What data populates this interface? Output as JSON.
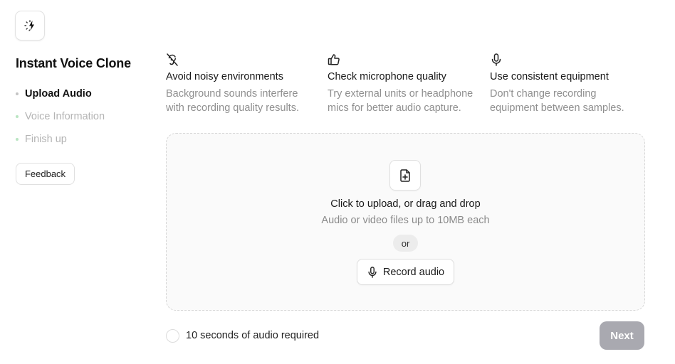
{
  "sidebar": {
    "logo_icon": "loading-bolt-icon",
    "title": "Instant Voice Clone",
    "steps": [
      {
        "label": "Upload Audio",
        "state": "active"
      },
      {
        "label": "Voice Information",
        "state": "inactive"
      },
      {
        "label": "Finish up",
        "state": "inactive"
      }
    ],
    "feedback_label": "Feedback"
  },
  "tips": [
    {
      "icon": "ear-off-icon",
      "title": "Avoid noisy environments",
      "desc_line1": "Background sounds interfere",
      "desc_line2": "with recording quality results."
    },
    {
      "icon": "thumbs-up-icon",
      "title": "Check microphone quality",
      "desc_line1": "Try external units or headphone",
      "desc_line2": "mics for better audio capture."
    },
    {
      "icon": "mic-icon",
      "title": "Use consistent equipment",
      "desc_line1": "Don't change recording",
      "desc_line2": "equipment between samples."
    }
  ],
  "upload": {
    "icon": "file-plus-icon",
    "title": "Click to upload, or drag and drop",
    "subtitle": "Audio or video files up to 10MB each",
    "or_label": "or",
    "record_label": "Record audio",
    "record_icon": "mic-icon"
  },
  "footer": {
    "requirement_text": "10 seconds of audio required",
    "next_label": "Next"
  },
  "colors": {
    "next_disabled": "#a9a9b0",
    "step_active_dot": "#c4c4c4",
    "step_inactive_dot": "#b9e5c2",
    "muted_text": "#8f8f8f"
  }
}
